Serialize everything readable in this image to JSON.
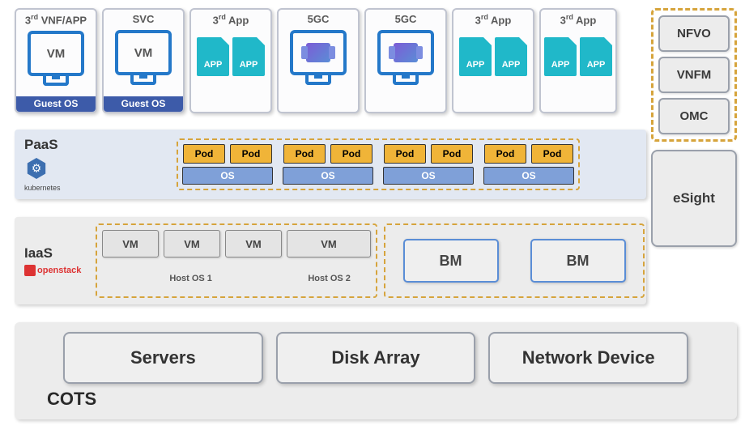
{
  "apps": [
    {
      "title_prefix": "3",
      "title_suffix": "rd",
      "title_rest": " VNF/APP",
      "body": "VM",
      "guest_os": "Guest OS",
      "icon": "monitor-vm"
    },
    {
      "title": "SVC",
      "body": "VM",
      "guest_os": "Guest OS",
      "icon": "monitor-vm"
    },
    {
      "title_prefix": "3",
      "title_suffix": "rd",
      "title_rest": " App",
      "icon": "app-doc"
    },
    {
      "title": "5GC",
      "icon": "monitor-cube"
    },
    {
      "title": "5GC",
      "icon": "monitor-cube"
    },
    {
      "title_prefix": "3",
      "title_suffix": "rd",
      "title_rest": " App",
      "icon": "app-doc"
    },
    {
      "title_prefix": "3",
      "title_suffix": "rd",
      "title_rest": " App",
      "icon": "app-doc"
    }
  ],
  "app_doc_label": "APP",
  "mgmt": {
    "boxes": [
      "NFVO",
      "VNFM",
      "OMC"
    ],
    "esight": "eSight"
  },
  "paas": {
    "title": "PaaS",
    "platform": "kubernetes",
    "pods": "Pod",
    "os": "OS",
    "groups": 4
  },
  "iaas": {
    "title": "IaaS",
    "platform": "openstack",
    "vm": "VM",
    "host1": "Host OS 1",
    "host2": "Host OS 2",
    "bm": "BM"
  },
  "cots": {
    "label": "COTS",
    "items": [
      "Servers",
      "Disk Array",
      "Network Device"
    ]
  }
}
